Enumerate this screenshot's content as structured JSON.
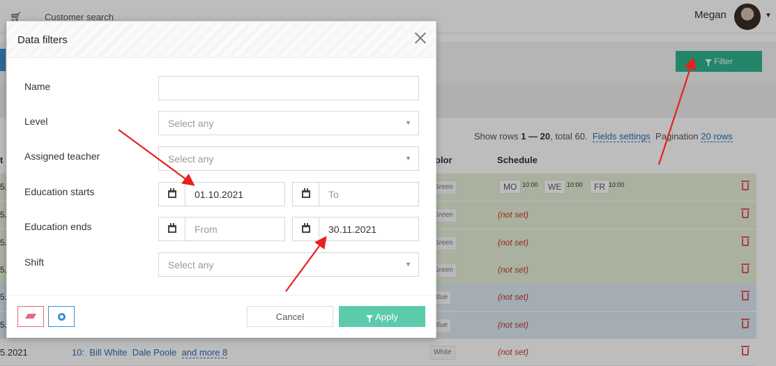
{
  "header": {
    "crumb": "Customer search",
    "user_name": "Megan",
    "cart_icon": "shopping-cart-icon"
  },
  "toolbar": {
    "filter_label": "Filter"
  },
  "table": {
    "show_rows_prefix": "Show rows ",
    "rows_range": "1 — 20",
    "total_text": ", total 60.",
    "fields_settings": "Fields settings",
    "pagination_label": "Pagination",
    "pagination_value": "20 rows",
    "col_left": "t",
    "col_color": "olor",
    "col_schedule": "Schedule",
    "rows": [
      {
        "left": "5.",
        "color": "Green",
        "schedule": ""
      },
      {
        "left": "5.",
        "color": "Green",
        "schedule": "(not set)"
      },
      {
        "left": "5.",
        "color": "Green",
        "schedule": "(not set)"
      },
      {
        "left": "5.",
        "color": "Green",
        "schedule": "(not set)"
      },
      {
        "left": "5.",
        "color": "Blue",
        "schedule": "(not set)"
      },
      {
        "left": "5.",
        "color": "Blue",
        "schedule": "(not set)"
      },
      {
        "left": "5.2021",
        "color": "White",
        "schedule": "(not set)"
      }
    ],
    "first_row_days": [
      {
        "day": "MO",
        "time": "10:00"
      },
      {
        "day": "WE",
        "time": "10:00"
      },
      {
        "day": "FR",
        "time": "10:00"
      }
    ],
    "last_row": {
      "id": "10:",
      "teacher_1": "Bill White",
      "teacher_2": "Dale Poole",
      "more": "and more 8"
    }
  },
  "modal": {
    "title": "Data filters",
    "fields": {
      "name_label": "Name",
      "name_value": "",
      "level_label": "Level",
      "level_placeholder": "Select any",
      "teacher_label": "Assigned teacher",
      "teacher_placeholder": "Select any",
      "starts_label": "Education starts",
      "starts_from": "01.10.2021",
      "starts_to_placeholder": "To",
      "ends_label": "Education ends",
      "ends_from_placeholder": "From",
      "ends_to": "30.11.2021",
      "shift_label": "Shift",
      "shift_placeholder": "Select any"
    },
    "buttons": {
      "cancel": "Cancel",
      "apply": "Apply"
    }
  },
  "colors": {
    "accent_green": "#30b48f",
    "apply_green": "#5ccbab",
    "row_green": "#e6f1d7",
    "row_blue": "#dde9f3",
    "annotation_red": "#e8201e",
    "link_blue": "#2a6db5"
  }
}
